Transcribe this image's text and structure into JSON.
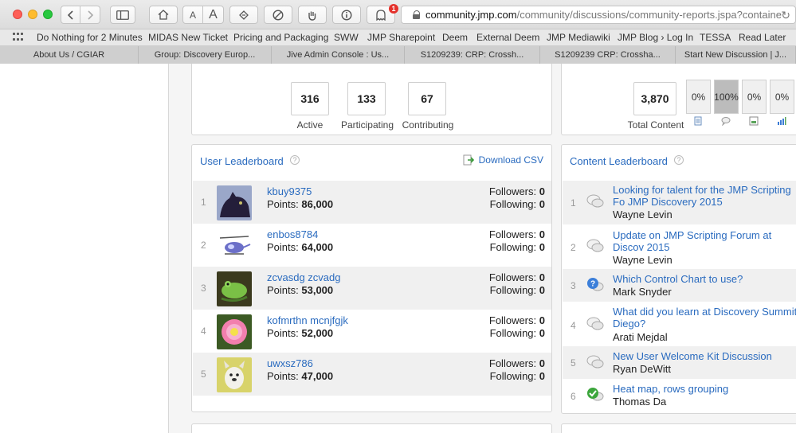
{
  "browser": {
    "url_host": "community.jmp.com",
    "url_path": "/community/discussions/community-reports.jspa?containe",
    "notification_count": "1",
    "font_small": "A",
    "font_large": "A"
  },
  "bookmarks": [
    "Do Nothing for 2 Minutes",
    "MIDAS New Ticket",
    "Pricing and Packaging",
    "SWW",
    "JMP Sharepoint",
    "Deem",
    "External Deem",
    "JMP Mediawiki",
    "JMP Blog › Log In",
    "TESSA",
    "Read Later"
  ],
  "tabs": [
    "About Us / CGIAR",
    "Group: Discovery Europ...",
    "Jive Admin Console : Us...",
    "S1209239: CRP: Crossh...",
    "S1209239 CRP: Crossha...",
    "Start New Discussion | J..."
  ],
  "stats": {
    "active": {
      "value": "316",
      "label": "Active"
    },
    "participating": {
      "value": "133",
      "label": "Participating"
    },
    "contributing": {
      "value": "67",
      "label": "Contributing"
    },
    "total_content": {
      "value": "3,870",
      "label": "Total Content"
    },
    "percentages": [
      "0%",
      "100%",
      "0%",
      "0%"
    ]
  },
  "user_leaderboard": {
    "title": "User Leaderboard",
    "download_label": "Download CSV",
    "points_label": "Points:",
    "followers_label": "Followers:",
    "following_label": "Following:",
    "rows": [
      {
        "rank": "1",
        "name": "kbuy9375",
        "points": "86,000",
        "followers": "0",
        "following": "0",
        "avatar": "panther"
      },
      {
        "rank": "2",
        "name": "enbos8784",
        "points": "64,000",
        "followers": "0",
        "following": "0",
        "avatar": "helicopter"
      },
      {
        "rank": "3",
        "name": "zcvasdg zcvadg",
        "points": "53,000",
        "followers": "0",
        "following": "0",
        "avatar": "frog"
      },
      {
        "rank": "4",
        "name": "kofmrthn mcnjfgjk",
        "points": "52,000",
        "followers": "0",
        "following": "0",
        "avatar": "flower"
      },
      {
        "rank": "5",
        "name": "uwxsz786",
        "points": "47,000",
        "followers": "0",
        "following": "0",
        "avatar": "dog"
      }
    ]
  },
  "content_leaderboard": {
    "title": "Content Leaderboard",
    "rows": [
      {
        "rank": "1",
        "title": "Looking for talent for the JMP Scripting Fo JMP Discovery 2015",
        "author": "Wayne Levin",
        "icon": "discussion"
      },
      {
        "rank": "2",
        "title": "Update on JMP Scripting Forum at Discov 2015",
        "author": "Wayne Levin",
        "icon": "discussion"
      },
      {
        "rank": "3",
        "title": "Which Control Chart to use?",
        "author": "Mark Snyder",
        "icon": "question"
      },
      {
        "rank": "4",
        "title": "What did you learn at Discovery Summit i Diego?",
        "author": "Arati Mejdal",
        "icon": "discussion"
      },
      {
        "rank": "5",
        "title": "New User Welcome Kit Discussion",
        "author": "Ryan DeWitt",
        "icon": "discussion"
      },
      {
        "rank": "6",
        "title": "Heat map, rows grouping",
        "author": "Thomas Da",
        "icon": "answered"
      }
    ]
  }
}
